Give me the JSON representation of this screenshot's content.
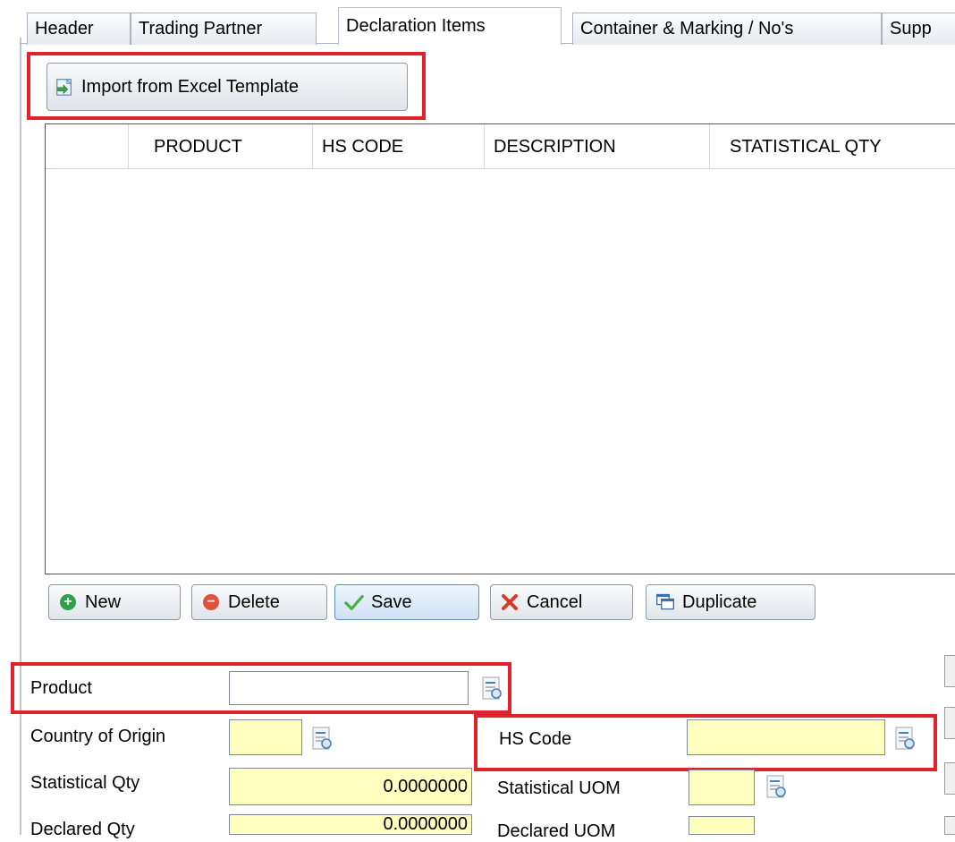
{
  "tabs": [
    {
      "label": "Header",
      "active": false
    },
    {
      "label": "Trading Partner",
      "active": false
    },
    {
      "label": "Declaration Items",
      "active": true
    },
    {
      "label": "Container & Marking / No's",
      "active": false
    },
    {
      "label": "Supp",
      "active": false
    }
  ],
  "import_button": {
    "label": "Import from Excel Template",
    "icon": "excel-import-icon"
  },
  "grid": {
    "columns": [
      "PRODUCT",
      "HS CODE",
      "DESCRIPTION",
      "STATISTICAL QTY"
    ],
    "rows": []
  },
  "actions": {
    "new": "New",
    "delete": "Delete",
    "save": "Save",
    "cancel": "Cancel",
    "duplicate": "Duplicate"
  },
  "form": {
    "product": {
      "label": "Product",
      "value": ""
    },
    "country_of_origin": {
      "label": "Country of Origin",
      "value": ""
    },
    "hs_code": {
      "label": "HS Code",
      "value": ""
    },
    "statistical_qty": {
      "label": "Statistical Qty",
      "value": "0.0000000"
    },
    "statistical_uom": {
      "label": "Statistical UOM",
      "value": ""
    },
    "declared_qty": {
      "label": "Declared Qty",
      "value": "0.0000000"
    },
    "declared_uom": {
      "label": "Declared UOM",
      "value": ""
    }
  },
  "colors": {
    "highlight_red": "#e0222b",
    "required_field_yellow": "#ffffc0",
    "new_green": "#2fa04a",
    "delete_red": "#e2503a",
    "save_check_green": "#4bb043",
    "cancel_x_red": "#d83a2a"
  }
}
